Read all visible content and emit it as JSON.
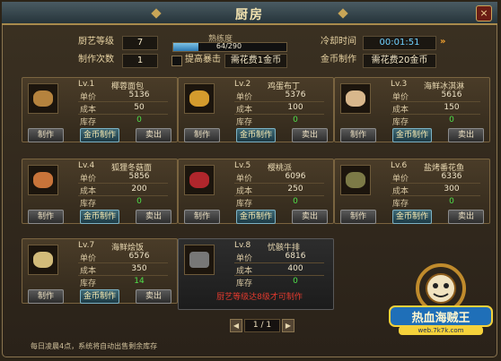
{
  "window": {
    "title": "厨房",
    "close_label": "×"
  },
  "stats": {
    "skill_level_label": "厨艺等级",
    "skill_level": "7",
    "count_label": "制作次数",
    "count": "1",
    "proficiency_label": "熟练度",
    "proficiency_text": "64/290",
    "proficiency_fraction": 0.22,
    "crit_label": "提高暴击",
    "crit_cost": "需花费1金币",
    "cooldown_label": "冷却时间",
    "cooldown": "00:01:51",
    "gold_label": "金币制作",
    "gold_cost": "需花费20金币"
  },
  "labels": {
    "price": "单价",
    "cost": "成本",
    "stock": "库存",
    "make": "制作",
    "gold_make": "金币制作",
    "sell": "卖出"
  },
  "dishes": [
    {
      "level": "Lv.1",
      "name": "椰蓉面包",
      "price": "5136",
      "cost": "50",
      "stock": "0",
      "color": "#b5833e"
    },
    {
      "level": "Lv.2",
      "name": "鸡蛋布丁",
      "price": "5376",
      "cost": "100",
      "stock": "0",
      "color": "#d49b2d"
    },
    {
      "level": "Lv.3",
      "name": "海鲜冰淇淋",
      "price": "5616",
      "cost": "150",
      "stock": "0",
      "color": "#d8b78c"
    },
    {
      "level": "Lv.4",
      "name": "狐狸冬菇面",
      "price": "5856",
      "cost": "200",
      "stock": "0",
      "color": "#c8743a"
    },
    {
      "level": "Lv.5",
      "name": "樱桃派",
      "price": "6096",
      "cost": "250",
      "stock": "0",
      "color": "#b0262c"
    },
    {
      "level": "Lv.6",
      "name": "盐烤番花鱼",
      "price": "6336",
      "cost": "300",
      "stock": "0",
      "color": "#7c7a47"
    },
    {
      "level": "Lv.7",
      "name": "海鲜烩饭",
      "price": "6576",
      "cost": "350",
      "stock": "14",
      "color": "#d2bb7a"
    },
    {
      "level": "Lv.8",
      "name": "忧骸牛排",
      "price": "6816",
      "cost": "400",
      "stock": "0",
      "color": "#777777"
    }
  ],
  "locked_message": "厨艺等级达8级才可制作",
  "pager": {
    "text": "1 / 1",
    "prev": "◀",
    "next": "▶"
  },
  "footer_note": "每日凌晨4点，系统将自动出售剩余库存",
  "arrow": "»",
  "logo": {
    "text1": "热血海贼王",
    "text2": "web.7k7k.com"
  }
}
